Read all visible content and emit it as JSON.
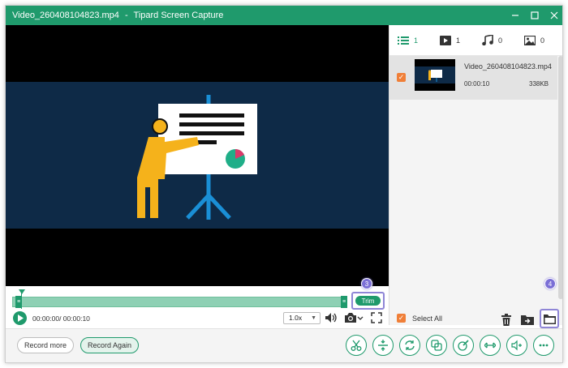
{
  "window": {
    "filename": "Video_260408104823.mp4",
    "separator": "-",
    "app_name": "Tipard Screen Capture"
  },
  "tabs": [
    {
      "name": "video-list",
      "count": "1",
      "icon": "list-icon"
    },
    {
      "name": "video",
      "count": "1",
      "icon": "play-box-icon"
    },
    {
      "name": "audio",
      "count": "0",
      "icon": "music-note-icon"
    },
    {
      "name": "image",
      "count": "0",
      "icon": "image-icon"
    }
  ],
  "file": {
    "name": "Video_260408104823.mp4",
    "duration": "00:00:10",
    "size": "338KB",
    "checked": true
  },
  "timeline": {
    "trim_label": "Trim",
    "step_trim": "3",
    "step_folder": "4"
  },
  "controls": {
    "time": "00:00:00/ 00:00:10",
    "speed": "1.0x"
  },
  "right_bottom": {
    "select_all_label": "Select All"
  },
  "bottom": {
    "record_more": "Record more",
    "record_again": "Record Again",
    "tools": [
      "cut-icon",
      "split-icon",
      "rotate-icon",
      "merge-icon",
      "edit-icon",
      "compress-icon",
      "volume-adjust-icon",
      "more-icon"
    ]
  },
  "colors": {
    "accent": "#1f9a6c",
    "checkbox": "#f07f38",
    "highlight": "#8f86d6",
    "video_bg": "#0e2a47"
  }
}
